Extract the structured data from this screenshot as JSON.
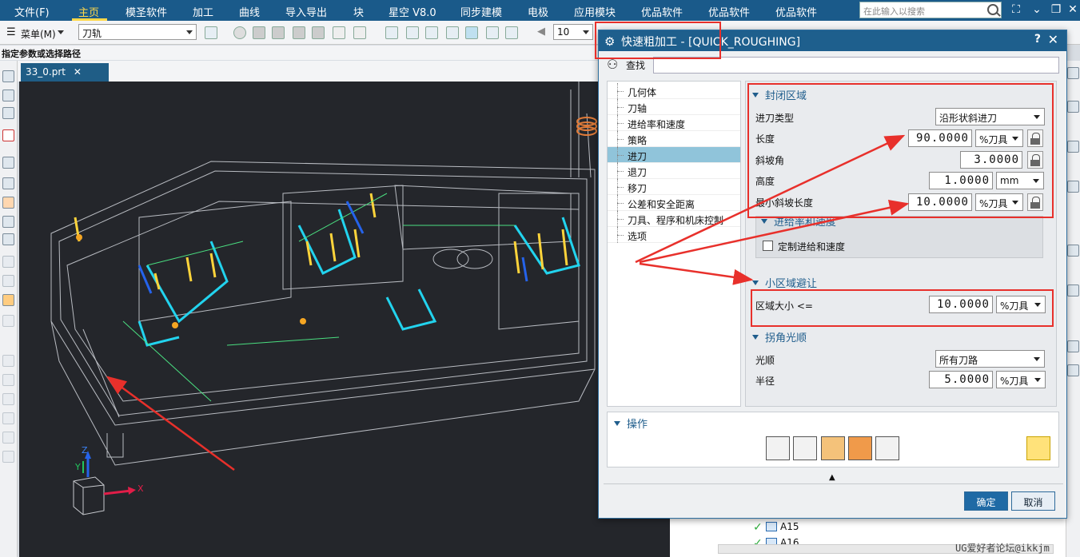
{
  "menubar": {
    "file": "文件(F)",
    "items": [
      "主页",
      "模圣软件",
      "加工",
      "曲线",
      "导入导出",
      "块",
      "星空 V8.0",
      "同步建模",
      "电极",
      "应用模块",
      "优品软件",
      "优品软件",
      "优品软件"
    ],
    "search_placeholder": "在此输入以搜索"
  },
  "toolbar": {
    "menu_label": "菜单(M)",
    "filter_value": "刀轨",
    "number_value": "10"
  },
  "statusline": "指定参数或选择路径",
  "doc_tab": "33_0.prt",
  "viewport": {
    "axis_x": "X",
    "axis_y": "Y",
    "axis_z": "Z"
  },
  "dialog": {
    "title": "快速粗加工 - [QUICK_ROUGHING]",
    "help": "?",
    "close": "✕",
    "find_label": "查找",
    "tree": [
      "几何体",
      "刀轴",
      "进给率和速度",
      "策略",
      "进刀",
      "退刀",
      "移刀",
      "公差和安全距离",
      "刀具、程序和机床控制",
      "选项"
    ],
    "tree_selected_index": 4,
    "closed_region": {
      "header": "封闭区域",
      "type_label": "进刀类型",
      "type_value": "沿形状斜进刀",
      "length_label": "长度",
      "length_value": "90.0000",
      "length_unit": "%刀具",
      "ramp_label": "斜坡角",
      "ramp_value": "3.0000",
      "height_label": "高度",
      "height_value": "1.0000",
      "height_unit": "mm",
      "min_ramp_label": "最小斜坡长度",
      "min_ramp_value": "10.0000",
      "min_ramp_unit": "%刀具"
    },
    "feed_sub": {
      "header": "进给率和速度",
      "custom_label": "定制进给和速度"
    },
    "small_area": {
      "header": "小区域避让",
      "size_label": "区域大小 <=",
      "size_value": "10.0000",
      "size_unit": "%刀具"
    },
    "corner": {
      "header": "拐角光顺",
      "smooth_label": "光顺",
      "smooth_value": "所有刀路",
      "radius_label": "半径",
      "radius_value": "5.0000",
      "radius_unit": "%刀具"
    },
    "operations_header": "操作",
    "ok": "确定",
    "cancel": "取消"
  },
  "navtree": [
    "A15",
    "A16"
  ],
  "watermark": "UG爱好者论坛@ikkjm",
  "colors": {
    "title_blue": "#1e5f8d",
    "menubar": "#1a5a8a",
    "highlight_red": "#e8302b",
    "selected_tree": "#90c4da",
    "viewport_bg": "#24262b"
  }
}
